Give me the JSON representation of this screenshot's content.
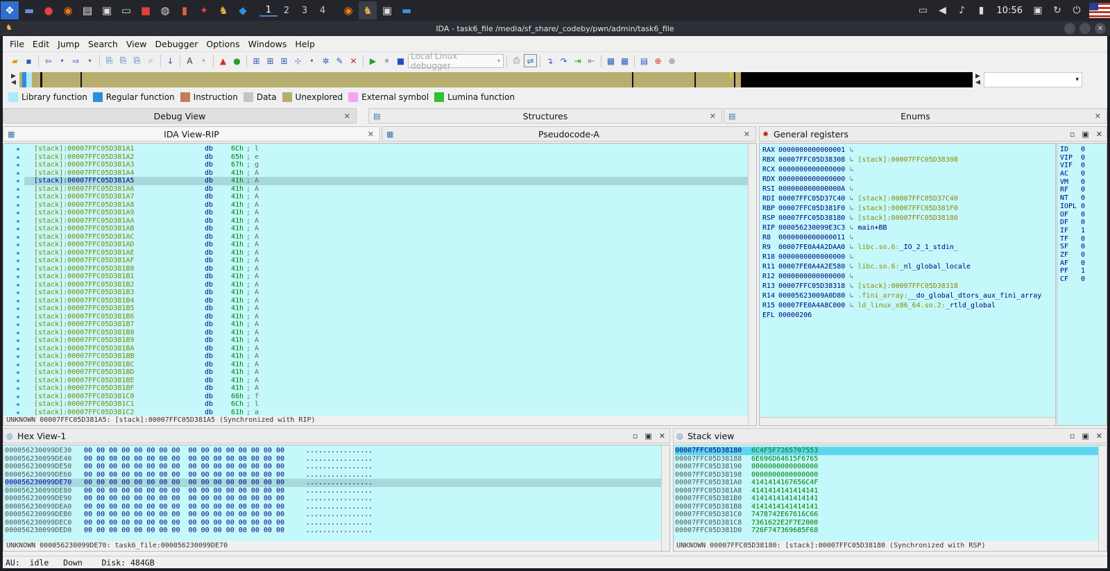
{
  "window": {
    "title": "IDA - task6_file /media/sf_share/_codeby/pwn/admin/task6_file"
  },
  "panel": {
    "workspaces": [
      "1",
      "2",
      "3",
      "4"
    ],
    "clock": "10:56"
  },
  "menu": [
    "File",
    "Edit",
    "Jump",
    "Search",
    "View",
    "Debugger",
    "Options",
    "Windows",
    "Help"
  ],
  "toolbar": {
    "debugger": "Local Linux debugger"
  },
  "legend": [
    {
      "label": "Library function",
      "color": "#aee9f9"
    },
    {
      "label": "Regular function",
      "color": "#2a8ee0"
    },
    {
      "label": "Instruction",
      "color": "#c27f57"
    },
    {
      "label": "Data",
      "color": "#c4c4c4"
    },
    {
      "label": "Unexplored",
      "color": "#b7ae6e"
    },
    {
      "label": "External symbol",
      "color": "#f7a3f2"
    },
    {
      "label": "Lumina function",
      "color": "#30c030"
    }
  ],
  "tabs": {
    "debug_view": "Debug View",
    "structures": "Structures",
    "enums": "Enums",
    "ida_view": "IDA View-RIP",
    "pseudocode": "Pseudocode-A"
  },
  "disasm": {
    "lines": [
      {
        "addr": "[stack]:00007FFC05D381A1",
        "op": "db",
        "val": "6Ch",
        "cmt": "; l"
      },
      {
        "addr": "[stack]:00007FFC05D381A2",
        "op": "db",
        "val": "65h",
        "cmt": "; e"
      },
      {
        "addr": "[stack]:00007FFC05D381A3",
        "op": "db",
        "val": "67h",
        "cmt": "; g"
      },
      {
        "addr": "[stack]:00007FFC05D381A4",
        "op": "db",
        "val": "41h",
        "cmt": "; A"
      },
      {
        "addr": "[stack]:00007FFC05D381A5",
        "op": "db",
        "val": "41h",
        "cmt": "; A"
      },
      {
        "addr": "[stack]:00007FFC05D381A6",
        "op": "db",
        "val": "41h",
        "cmt": "; A"
      },
      {
        "addr": "[stack]:00007FFC05D381A7",
        "op": "db",
        "val": "41h",
        "cmt": "; A"
      },
      {
        "addr": "[stack]:00007FFC05D381A8",
        "op": "db",
        "val": "41h",
        "cmt": "; A"
      },
      {
        "addr": "[stack]:00007FFC05D381A9",
        "op": "db",
        "val": "41h",
        "cmt": "; A"
      },
      {
        "addr": "[stack]:00007FFC05D381AA",
        "op": "db",
        "val": "41h",
        "cmt": "; A"
      },
      {
        "addr": "[stack]:00007FFC05D381AB",
        "op": "db",
        "val": "41h",
        "cmt": "; A"
      },
      {
        "addr": "[stack]:00007FFC05D381AC",
        "op": "db",
        "val": "41h",
        "cmt": "; A"
      },
      {
        "addr": "[stack]:00007FFC05D381AD",
        "op": "db",
        "val": "41h",
        "cmt": "; A"
      },
      {
        "addr": "[stack]:00007FFC05D381AE",
        "op": "db",
        "val": "41h",
        "cmt": "; A"
      },
      {
        "addr": "[stack]:00007FFC05D381AF",
        "op": "db",
        "val": "41h",
        "cmt": "; A"
      },
      {
        "addr": "[stack]:00007FFC05D381B0",
        "op": "db",
        "val": "41h",
        "cmt": "; A"
      },
      {
        "addr": "[stack]:00007FFC05D381B1",
        "op": "db",
        "val": "41h",
        "cmt": "; A"
      },
      {
        "addr": "[stack]:00007FFC05D381B2",
        "op": "db",
        "val": "41h",
        "cmt": "; A"
      },
      {
        "addr": "[stack]:00007FFC05D381B3",
        "op": "db",
        "val": "41h",
        "cmt": "; A"
      },
      {
        "addr": "[stack]:00007FFC05D381B4",
        "op": "db",
        "val": "41h",
        "cmt": "; A"
      },
      {
        "addr": "[stack]:00007FFC05D381B5",
        "op": "db",
        "val": "41h",
        "cmt": "; A"
      },
      {
        "addr": "[stack]:00007FFC05D381B6",
        "op": "db",
        "val": "41h",
        "cmt": "; A"
      },
      {
        "addr": "[stack]:00007FFC05D381B7",
        "op": "db",
        "val": "41h",
        "cmt": "; A"
      },
      {
        "addr": "[stack]:00007FFC05D381B8",
        "op": "db",
        "val": "41h",
        "cmt": "; A"
      },
      {
        "addr": "[stack]:00007FFC05D381B9",
        "op": "db",
        "val": "41h",
        "cmt": "; A"
      },
      {
        "addr": "[stack]:00007FFC05D381BA",
        "op": "db",
        "val": "41h",
        "cmt": "; A"
      },
      {
        "addr": "[stack]:00007FFC05D381BB",
        "op": "db",
        "val": "41h",
        "cmt": "; A"
      },
      {
        "addr": "[stack]:00007FFC05D381BC",
        "op": "db",
        "val": "41h",
        "cmt": "; A"
      },
      {
        "addr": "[stack]:00007FFC05D381BD",
        "op": "db",
        "val": "41h",
        "cmt": "; A"
      },
      {
        "addr": "[stack]:00007FFC05D381BE",
        "op": "db",
        "val": "41h",
        "cmt": "; A"
      },
      {
        "addr": "[stack]:00007FFC05D381BF",
        "op": "db",
        "val": "41h",
        "cmt": "; A"
      },
      {
        "addr": "[stack]:00007FFC05D381C0",
        "op": "db",
        "val": "66h",
        "cmt": "; f"
      },
      {
        "addr": "[stack]:00007FFC05D381C1",
        "op": "db",
        "val": "6Ch",
        "cmt": "; l"
      },
      {
        "addr": "[stack]:00007FFC05D381C2",
        "op": "db",
        "val": "61h",
        "cmt": "; a"
      }
    ],
    "highlight_index": 4,
    "status": "UNKNOWN 00007FFC05D381A5: [stack]:00007FFC05D381A5 (Synchronized with RIP)"
  },
  "registers": {
    "title": "General registers",
    "rows": [
      {
        "name": "RAX",
        "value": "0000000000000001",
        "ref": "",
        "sym": ""
      },
      {
        "name": "RBX",
        "value": "00007FFC05D38308",
        "ref": "[stack]:00007FFC05D38308",
        "sym": ""
      },
      {
        "name": "RCX",
        "value": "0000000000000000",
        "ref": "",
        "sym": ""
      },
      {
        "name": "RDX",
        "value": "0000000000000000",
        "ref": "",
        "sym": ""
      },
      {
        "name": "RSI",
        "value": "000000000000000A",
        "ref": "",
        "sym": ""
      },
      {
        "name": "RDI",
        "value": "00007FFC05D37C40",
        "ref": "[stack]:00007FFC05D37C40",
        "sym": ""
      },
      {
        "name": "RBP",
        "value": "00007FFC05D381F0",
        "ref": "[stack]:00007FFC05D381F0",
        "sym": ""
      },
      {
        "name": "RSP",
        "value": "00007FFC05D38180",
        "ref": "[stack]:00007FFC05D38180",
        "sym": ""
      },
      {
        "name": "RIP",
        "value": "000056230099E3C3",
        "ref": "",
        "sym": "main+BB"
      },
      {
        "name": "R8",
        "value": "0000000000000011",
        "ref": "",
        "sym": ""
      },
      {
        "name": "R9",
        "value": "00007FE0A4A2DAA0",
        "ref": "libc.so.6:",
        "sym": "_IO_2_1_stdin_"
      },
      {
        "name": "R10",
        "value": "0000000000000000",
        "ref": "",
        "sym": ""
      },
      {
        "name": "R11",
        "value": "00007FE0A4A2E580",
        "ref": "libc.so.6:",
        "sym": "_nl_global_locale"
      },
      {
        "name": "R12",
        "value": "0000000000000000",
        "ref": "",
        "sym": ""
      },
      {
        "name": "R13",
        "value": "00007FFC05D38318",
        "ref": "[stack]:00007FFC05D38318",
        "sym": ""
      },
      {
        "name": "R14",
        "value": "00005623009A0D80",
        "ref": ".fini_array:",
        "sym": "__do_global_dtors_aux_fini_array"
      },
      {
        "name": "R15",
        "value": "00007FE0A4A8C000",
        "ref": "ld_linux_x86_64.so.2:",
        "sym": "_rtld_global"
      },
      {
        "name": "EFL",
        "value": "00000206",
        "ref": "",
        "sym": ""
      }
    ],
    "flags": [
      {
        "name": "ID",
        "value": "0"
      },
      {
        "name": "VIP",
        "value": "0"
      },
      {
        "name": "VIF",
        "value": "0"
      },
      {
        "name": "AC",
        "value": "0"
      },
      {
        "name": "VM",
        "value": "0"
      },
      {
        "name": "RF",
        "value": "0"
      },
      {
        "name": "NT",
        "value": "0"
      },
      {
        "name": "IOPL",
        "value": "0"
      },
      {
        "name": "OF",
        "value": "0"
      },
      {
        "name": "DF",
        "value": "0"
      },
      {
        "name": "IF",
        "value": "1"
      },
      {
        "name": "TF",
        "value": "0"
      },
      {
        "name": "SF",
        "value": "0"
      },
      {
        "name": "ZF",
        "value": "0"
      },
      {
        "name": "AF",
        "value": "0"
      },
      {
        "name": "PF",
        "value": "1"
      },
      {
        "name": "CF",
        "value": "0"
      }
    ]
  },
  "hexview": {
    "title": "Hex View-1",
    "rows": [
      {
        "addr": "000056230099DE30",
        "bytes": "00 00 00 00 00 00 00 00  00 00 00 00 00 00 00 00",
        "ascii": "................"
      },
      {
        "addr": "000056230099DE40",
        "bytes": "00 00 00 00 00 00 00 00  00 00 00 00 00 00 00 00",
        "ascii": "................"
      },
      {
        "addr": "000056230099DE50",
        "bytes": "00 00 00 00 00 00 00 00  00 00 00 00 00 00 00 00",
        "ascii": "................"
      },
      {
        "addr": "000056230099DE60",
        "bytes": "00 00 00 00 00 00 00 00  00 00 00 00 00 00 00 00",
        "ascii": "................"
      },
      {
        "addr": "000056230099DE70",
        "bytes": "00 00 00 00 00 00 00 00  00 00 00 00 00 00 00 00",
        "ascii": "................"
      },
      {
        "addr": "000056230099DE80",
        "bytes": "00 00 00 00 00 00 00 00  00 00 00 00 00 00 00 00",
        "ascii": "................"
      },
      {
        "addr": "000056230099DE90",
        "bytes": "00 00 00 00 00 00 00 00  00 00 00 00 00 00 00 00",
        "ascii": "................"
      },
      {
        "addr": "000056230099DEA0",
        "bytes": "00 00 00 00 00 00 00 00  00 00 00 00 00 00 00 00",
        "ascii": "................"
      },
      {
        "addr": "000056230099DEB0",
        "bytes": "00 00 00 00 00 00 00 00  00 00 00 00 00 00 00 00",
        "ascii": "................"
      },
      {
        "addr": "000056230099DEC0",
        "bytes": "00 00 00 00 00 00 00 00  00 00 00 00 00 00 00 00",
        "ascii": "................"
      },
      {
        "addr": "000056230099DED0",
        "bytes": "00 00 00 00 00 00 00 00  00 00 00 00 00 00 00 00",
        "ascii": "................"
      }
    ],
    "highlight_index": 4,
    "status": "UNKNOWN 000056230099DE70: task6_file:000056230099DE70"
  },
  "stackview": {
    "title": "Stack view",
    "rows": [
      {
        "addr": "00007FFC05D38180",
        "value": "6C4F5F7265707553"
      },
      {
        "addr": "00007FFC05D38188",
        "value": "6E696D64615F6765"
      },
      {
        "addr": "00007FFC05D38190",
        "value": "0000000000000000"
      },
      {
        "addr": "00007FFC05D38198",
        "value": "0000000000000000"
      },
      {
        "addr": "00007FFC05D381A0",
        "value": "4141414167656C4F"
      },
      {
        "addr": "00007FFC05D381A8",
        "value": "4141414141414141"
      },
      {
        "addr": "00007FFC05D381B0",
        "value": "4141414141414141"
      },
      {
        "addr": "00007FFC05D381B8",
        "value": "4141414141414141"
      },
      {
        "addr": "00007FFC05D381C0",
        "value": "7478742E67616C66"
      },
      {
        "addr": "00007FFC05D381C8",
        "value": "7361622E2F7E2000"
      },
      {
        "addr": "00007FFC05D381D0",
        "value": "726F747369685F68"
      }
    ],
    "status": "UNKNOWN 00007FFC05D38180: [stack]:00007FFC05D38180 (Synchronized with RSP)"
  },
  "statusbar": {
    "text": "AU:  idle   Down    Disk: 484GB"
  }
}
